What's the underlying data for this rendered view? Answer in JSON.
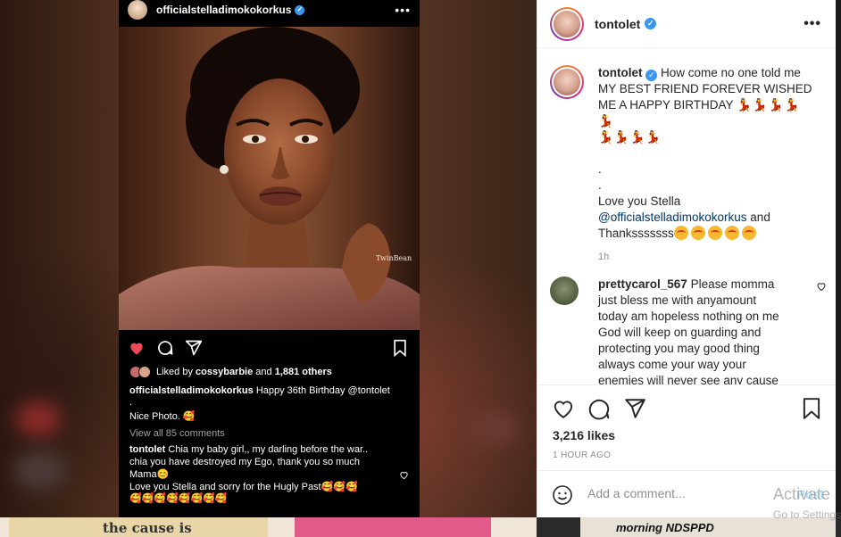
{
  "colors": {
    "accent_blue": "#0095f6",
    "verified_blue": "#3897f0",
    "heart_red": "#ed4956",
    "muted_text": "#8e8e8e",
    "mention": "#00376b"
  },
  "embedded_post": {
    "username": "officialstelladimokokorkus",
    "more_icon": "more-horizontal-icon",
    "photo_watermark": "TwinBean",
    "liked_by_user": "cossybarbie",
    "liked_others": "1,881 others",
    "caption_user": "officialstelladimokokorkus",
    "caption_text": "Happy 36th Birthday @tontolet",
    "caption_dot": ".",
    "caption_line2": "Nice Photo. 🥰",
    "view_all": "View all 85 comments",
    "comment_user": "tontolet",
    "comment_line1": "Chia my baby girl,, my darling before the war..",
    "comment_line2": "chia you have destroyed my Ego, thank you so much",
    "comment_line3": "Mama😊",
    "comment_line4": "Love you Stella and sorry for the Hugly Past🥰🥰🥰",
    "comment_line5": "🥰🥰🥰🥰🥰🥰🥰🥰"
  },
  "background": {
    "strip_text": "the cause is",
    "strip_right_text": "morning NDSPPD"
  },
  "panel": {
    "header": {
      "username": "tontolet",
      "more_icon": "more-horizontal-icon"
    },
    "caption": {
      "username": "tontolet",
      "text_line1": "How come no one told me",
      "text_line2": "MY BEST FRIEND FOREVER WISHED",
      "text_line3": "ME A HAPPY BIRTHDAY",
      "emoji_row1": "💃💃💃💃💃",
      "emoji_row2": "💃💃💃💃",
      "dot1": ".",
      "dot2": ".",
      "love_line": "Love you Stella",
      "mention": "@officialstelladimokokorkus",
      "and": "and",
      "thanks": "Thanksssssss",
      "time": "1h"
    },
    "comment": {
      "username": "prettycarol_567",
      "text": "Please momma just bless me with anyamount today am hopeless nothing on me God will keep on guarding and protecting you may good thing always come your way your enemies will never see any cause"
    },
    "likes": "3,216 likes",
    "time_ago": "1 HOUR AGO",
    "add_comment_placeholder": "Add a comment...",
    "post_label": "Post"
  },
  "os_watermark": {
    "title": "Activate",
    "subtitle": "Go to Settings"
  }
}
